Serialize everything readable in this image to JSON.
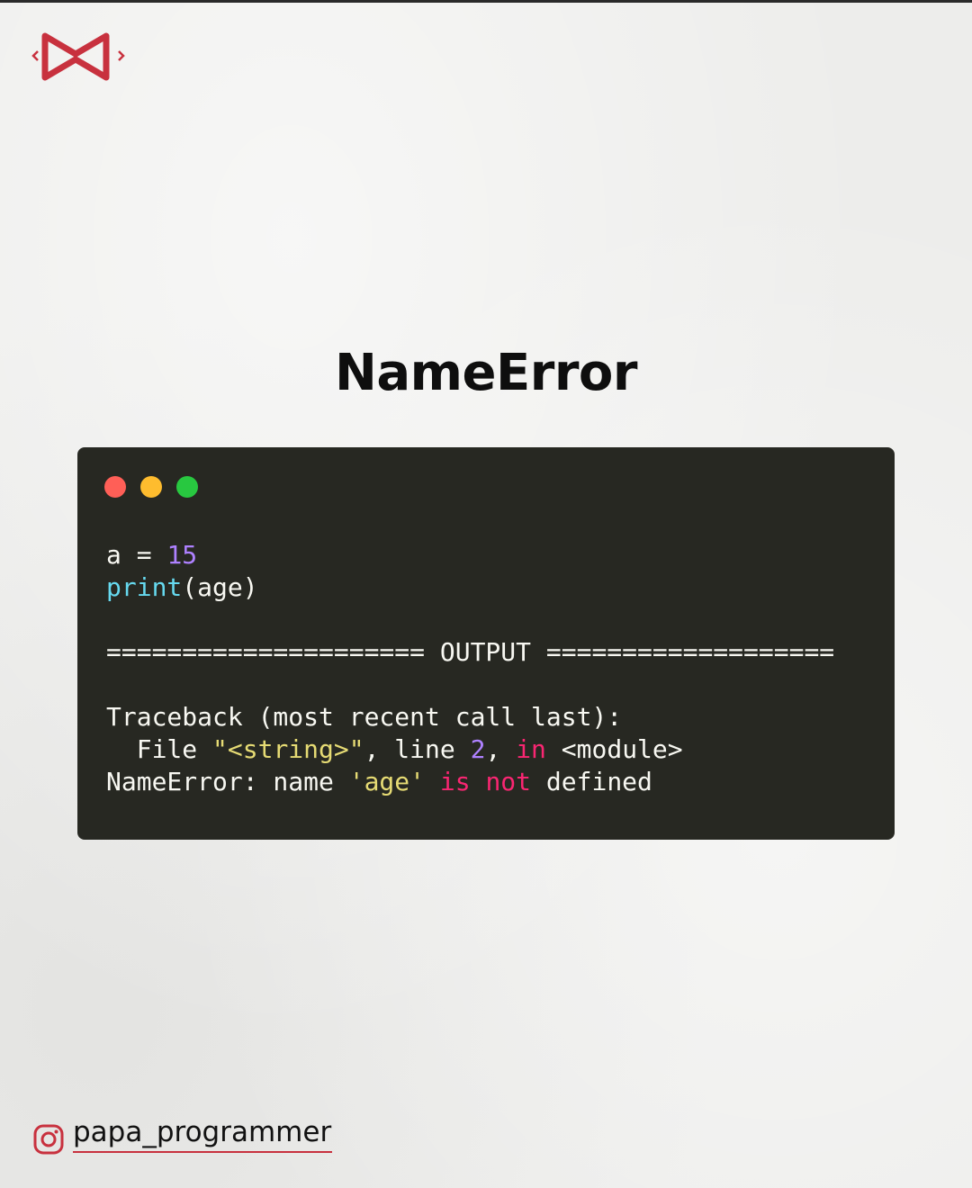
{
  "brand": {
    "logo_icon": "bowtie-code-logo-icon",
    "logo_color": "#c8313e"
  },
  "title": "NameError",
  "window": {
    "controls": [
      "close",
      "minimize",
      "maximize"
    ],
    "control_colors": {
      "close": "#ff5f57",
      "minimize": "#febc2e",
      "maximize": "#28c840"
    },
    "background": "#272822"
  },
  "code": {
    "line1": {
      "var": "a",
      "op": " = ",
      "num": "15"
    },
    "line2": {
      "fn": "print",
      "args": "(age)"
    },
    "separator": "===================== OUTPUT ===================",
    "tb1": "Traceback (most recent call last):",
    "tb2": {
      "pre": "  File ",
      "str": "\"<string>\"",
      "mid": ", line ",
      "num": "2",
      "comma": ", ",
      "kw": "in",
      "post": " <module>"
    },
    "tb3": {
      "pre": "NameError: name ",
      "str": "'age'",
      "sp1": " ",
      "kw1": "is",
      "sp2": " ",
      "kw2": "not",
      "post": " defined"
    }
  },
  "footer": {
    "icon": "instagram-icon",
    "handle": "papa_programmer"
  }
}
